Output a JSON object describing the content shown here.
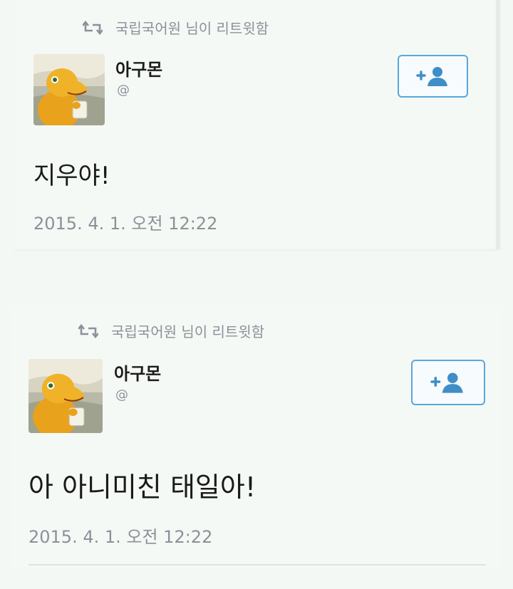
{
  "tweets": [
    {
      "retweet_text": "국립국어원 님이 리트윗함",
      "author_name": "아구몬",
      "author_handle": "@",
      "text": "지우야!",
      "timestamp": "2015. 4. 1. 오전 12:22"
    },
    {
      "retweet_text": "국립국어원 님이 리트윗함",
      "author_name": "아구몬",
      "author_handle": "@",
      "text": "아 아니미친 태일아!",
      "timestamp": "2015. 4. 1. 오전 12:22"
    }
  ],
  "icons": {
    "retweet": "retweet-icon",
    "follow": "add-user-icon"
  },
  "colors": {
    "accent": "#5aa7d8",
    "muted_text": "#8b9199",
    "body_text": "#1a1a1a",
    "background": "#f4f8f4"
  }
}
